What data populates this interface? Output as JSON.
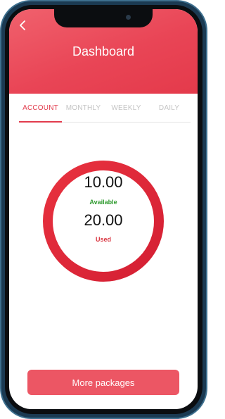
{
  "header": {
    "title": "Dashboard"
  },
  "tabs": [
    {
      "label": "ACCOUNT",
      "active": true
    },
    {
      "label": "MONTHLY",
      "active": false
    },
    {
      "label": "WEEKLY",
      "active": false
    },
    {
      "label": "DAILY",
      "active": false
    }
  ],
  "balance": {
    "available_value": "10.00",
    "available_label": "Available",
    "used_value": "20.00",
    "used_label": "Used"
  },
  "actions": {
    "more_packages": "More packages"
  },
  "colors": {
    "accent": "#e94556",
    "available": "#2e9a2e",
    "used": "#d9343f"
  }
}
